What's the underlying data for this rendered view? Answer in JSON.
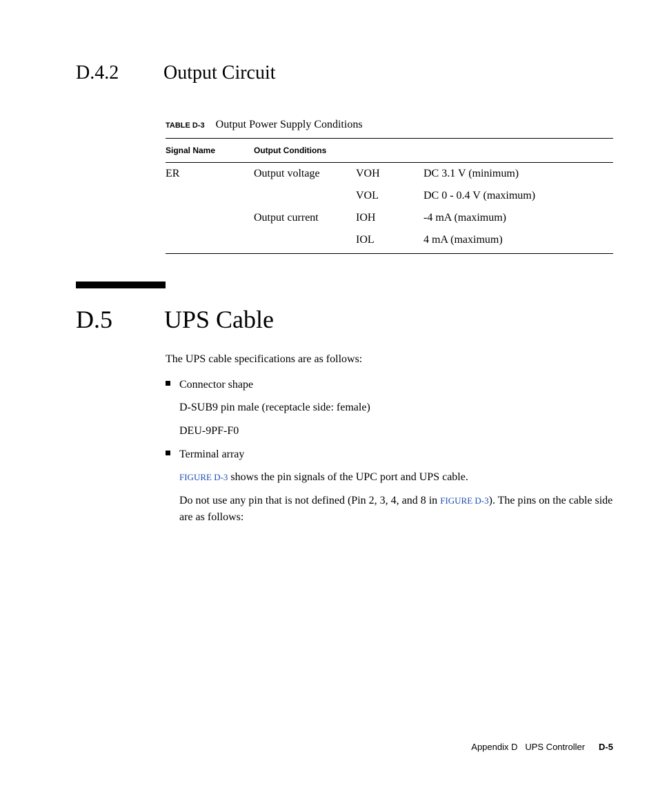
{
  "section1": {
    "number": "D.4.2",
    "title": "Output Circuit"
  },
  "table": {
    "caption_label": "TABLE D-3",
    "caption_text": "Output Power Supply Conditions",
    "headers": {
      "signal": "Signal Name",
      "conditions": "Output Conditions"
    },
    "rows": [
      {
        "signal": "ER",
        "cond": "Output voltage",
        "sym": "VOH",
        "val": "DC 3.1 V (minimum)"
      },
      {
        "signal": "",
        "cond": "",
        "sym": "VOL",
        "val": "DC 0 - 0.4 V (maximum)"
      },
      {
        "signal": "",
        "cond": "Output current",
        "sym": "IOH",
        "val": "-4 mA (maximum)"
      },
      {
        "signal": "",
        "cond": "",
        "sym": "IOL",
        "val": "4 mA (maximum)"
      }
    ]
  },
  "section2": {
    "number": "D.5",
    "title": "UPS Cable",
    "intro": "The UPS cable specifications are as follows:",
    "item1_label": "Connector shape",
    "item1_line1": "D-SUB9 pin male (receptacle side: female)",
    "item1_line2": "DEU-9PF-F0",
    "item2_label": "Terminal array",
    "fig_ref": "FIGURE D-3",
    "item2_line1_suffix": " shows the pin signals of the UPC port and UPS cable.",
    "item2_line2_prefix": "Do not use any pin that is not defined (Pin 2, 3, 4, and 8 in ",
    "item2_line2_suffix": "). The pins on the cable side are as follows:"
  },
  "footer": {
    "appendix": "Appendix D",
    "title": "UPS Controller",
    "page": "D-5"
  }
}
